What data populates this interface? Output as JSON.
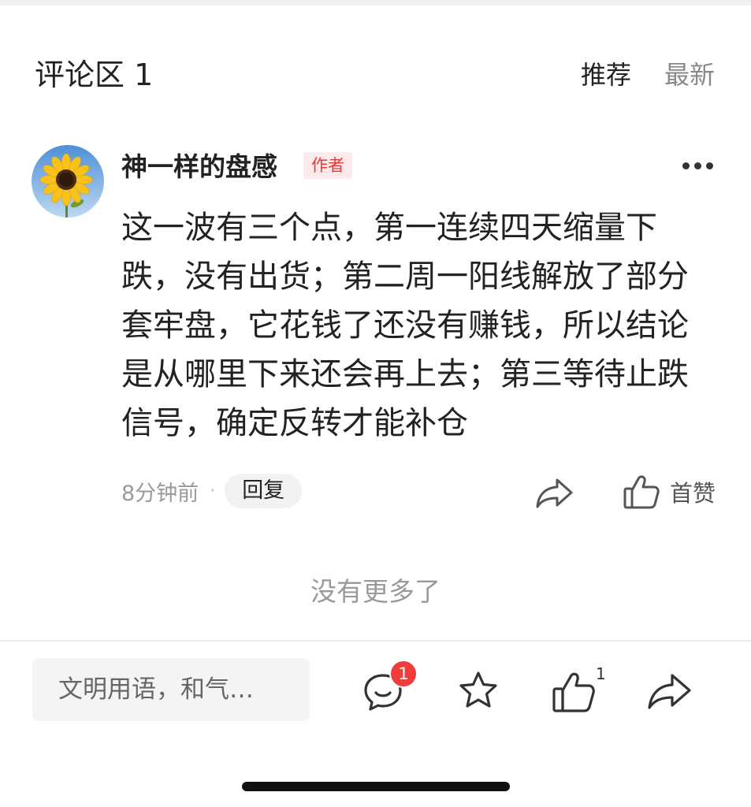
{
  "header": {
    "title": "评论区 1",
    "sort_options": [
      "推荐",
      "最新"
    ]
  },
  "comment": {
    "username": "神一样的盘感",
    "author_badge": "作者",
    "text": "这一波有三个点，第一连续四天缩量下跌，没有出货；第二周一阳线解放了部分套牢盘，它花钱了还没有赚钱，所以结论是从哪里下来还会再上去；第三等待止跌信号，确定反转才能补仓",
    "time": "8分钟前",
    "separator": "·",
    "reply_label": "回复",
    "like_label": "首赞"
  },
  "footer_text": "没有更多了",
  "bottom_bar": {
    "input_placeholder": "文明用语，和气…",
    "comment_badge": "1",
    "like_count": "1"
  },
  "colors": {
    "accent_red": "#f13c3c",
    "badge_bg": "#fdeaea",
    "muted_text": "#9a9a9a"
  },
  "icons": [
    "more-icon",
    "share-icon",
    "thumbs-up-icon",
    "comment-icon",
    "star-icon"
  ]
}
